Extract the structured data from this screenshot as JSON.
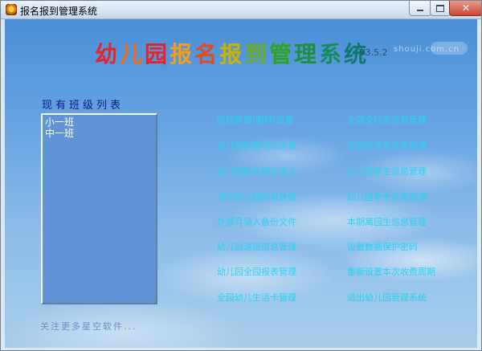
{
  "window": {
    "title": "报名报到管理系统"
  },
  "app_title": {
    "chars": [
      {
        "t": "幼",
        "c": "#e3242b"
      },
      {
        "t": "儿",
        "c": "#f26a1b"
      },
      {
        "t": "园",
        "c": "#e3242b"
      },
      {
        "t": "报",
        "c": "#f29d1e"
      },
      {
        "t": "名",
        "c": "#e24a1f"
      },
      {
        "t": "报",
        "c": "#c8b400"
      },
      {
        "t": "到",
        "c": "#6cae1e"
      },
      {
        "t": "管",
        "c": "#2fa31f"
      },
      {
        "t": "理",
        "c": "#1f8f3a"
      },
      {
        "t": "系",
        "c": "#158a5a"
      },
      {
        "t": "统",
        "c": "#0f7a6a"
      }
    ]
  },
  "version": "V3.5.2",
  "watermark": "shouji.com.cn",
  "class_panel": {
    "title": "现有班级列表",
    "items": [
      "小一班",
      "中一班"
    ]
  },
  "menu": {
    "col1": [
      "班级新建\\删除\\设置",
      "幼儿园收费项目设置",
      "幼儿园新生报名录入",
      "清空幼儿园所有数据",
      "外部月诵入备份文件",
      "幼儿园退班信息管理",
      "幼儿园全园报表管理",
      "全园幼儿生活卡管理"
    ],
    "col2": [
      "全园全托生信息管理",
      "全园走读生信息管理",
      "幼儿园新生信息管理",
      "幼儿园老生信息管理",
      "本期离园生信息管理",
      "设置数据保护密码",
      "重新设置本次收费周期",
      "退出幼儿园管理系统"
    ]
  },
  "footer_link": "关注更多星空软件...",
  "colors": {
    "menu_text": "#29d4ef",
    "list_bg": "#6094d6",
    "sky_top": "#4a8fd7"
  }
}
